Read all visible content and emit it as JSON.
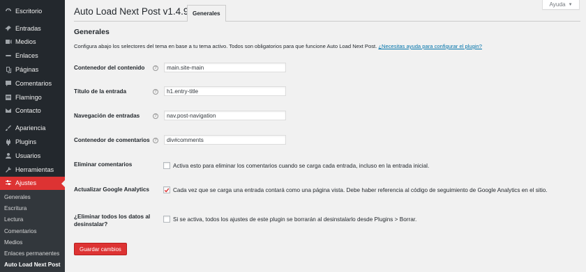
{
  "sidebar": {
    "items": [
      {
        "label": "Escritorio",
        "icon": "dashboard-icon"
      },
      {
        "label": "Entradas",
        "icon": "pin-icon"
      },
      {
        "label": "Medios",
        "icon": "media-icon"
      },
      {
        "label": "Enlaces",
        "icon": "links-icon"
      },
      {
        "label": "Páginas",
        "icon": "pages-icon"
      },
      {
        "label": "Comentarios",
        "icon": "comments-icon"
      },
      {
        "label": "Flamingo",
        "icon": "flamingo-icon"
      },
      {
        "label": "Contacto",
        "icon": "mail-icon"
      },
      {
        "label": "Apariencia",
        "icon": "brush-icon"
      },
      {
        "label": "Plugins",
        "icon": "plugin-icon"
      },
      {
        "label": "Usuarios",
        "icon": "users-icon"
      },
      {
        "label": "Herramientas",
        "icon": "tools-icon"
      },
      {
        "label": "Ajustes",
        "icon": "settings-icon"
      }
    ],
    "submenu": [
      "Generales",
      "Escritura",
      "Lectura",
      "Comentarios",
      "Medios",
      "Enlaces permanentes",
      "Auto Load Next Post"
    ]
  },
  "header": {
    "title": "Auto Load Next Post v1.4.9",
    "tab": "Generales",
    "help": "Ayuda"
  },
  "section": {
    "title": "Generales",
    "desc": "Configura abajo los selectores del tema en base a tu tema activo. Todos son obligatorios para que funcione Auto Load Next Post.",
    "help_link": "¿Necesitas ayuda para configurar el plugin?"
  },
  "fields": [
    {
      "label": "Contenedor del contenido",
      "value": "main.site-main"
    },
    {
      "label": "Título de la entrada",
      "value": "h1.entry-title"
    },
    {
      "label": "Navegación de entradas",
      "value": "nav.post-navigation"
    },
    {
      "label": "Contenedor de comentarios",
      "value": "div#comments"
    }
  ],
  "checkboxes": [
    {
      "label": "Eliminar comentarios",
      "text": "Activa esto para eliminar los comentarios cuando se carga cada entrada, incluso en la entrada inicial.",
      "checked": false
    },
    {
      "label": "Actualizar Google Analytics",
      "text": "Cada vez que se carga una entrada contará como una página vista. Debe haber referencia al código de seguimiento de Google Analytics en el sitio.",
      "checked": true
    },
    {
      "label_line1": "¿Eliminar todos los datos al",
      "label_line2": "desinstalar?",
      "text": "Si se activa, todos los ajustes de este plugin se borrarán al desinstalarlo desde Plugins > Borrar.",
      "checked": false
    }
  ],
  "save_button": "Guardar cambios",
  "colors": {
    "accent": "#dd3333",
    "sidebar": "#23282d",
    "link": "#0073aa"
  }
}
